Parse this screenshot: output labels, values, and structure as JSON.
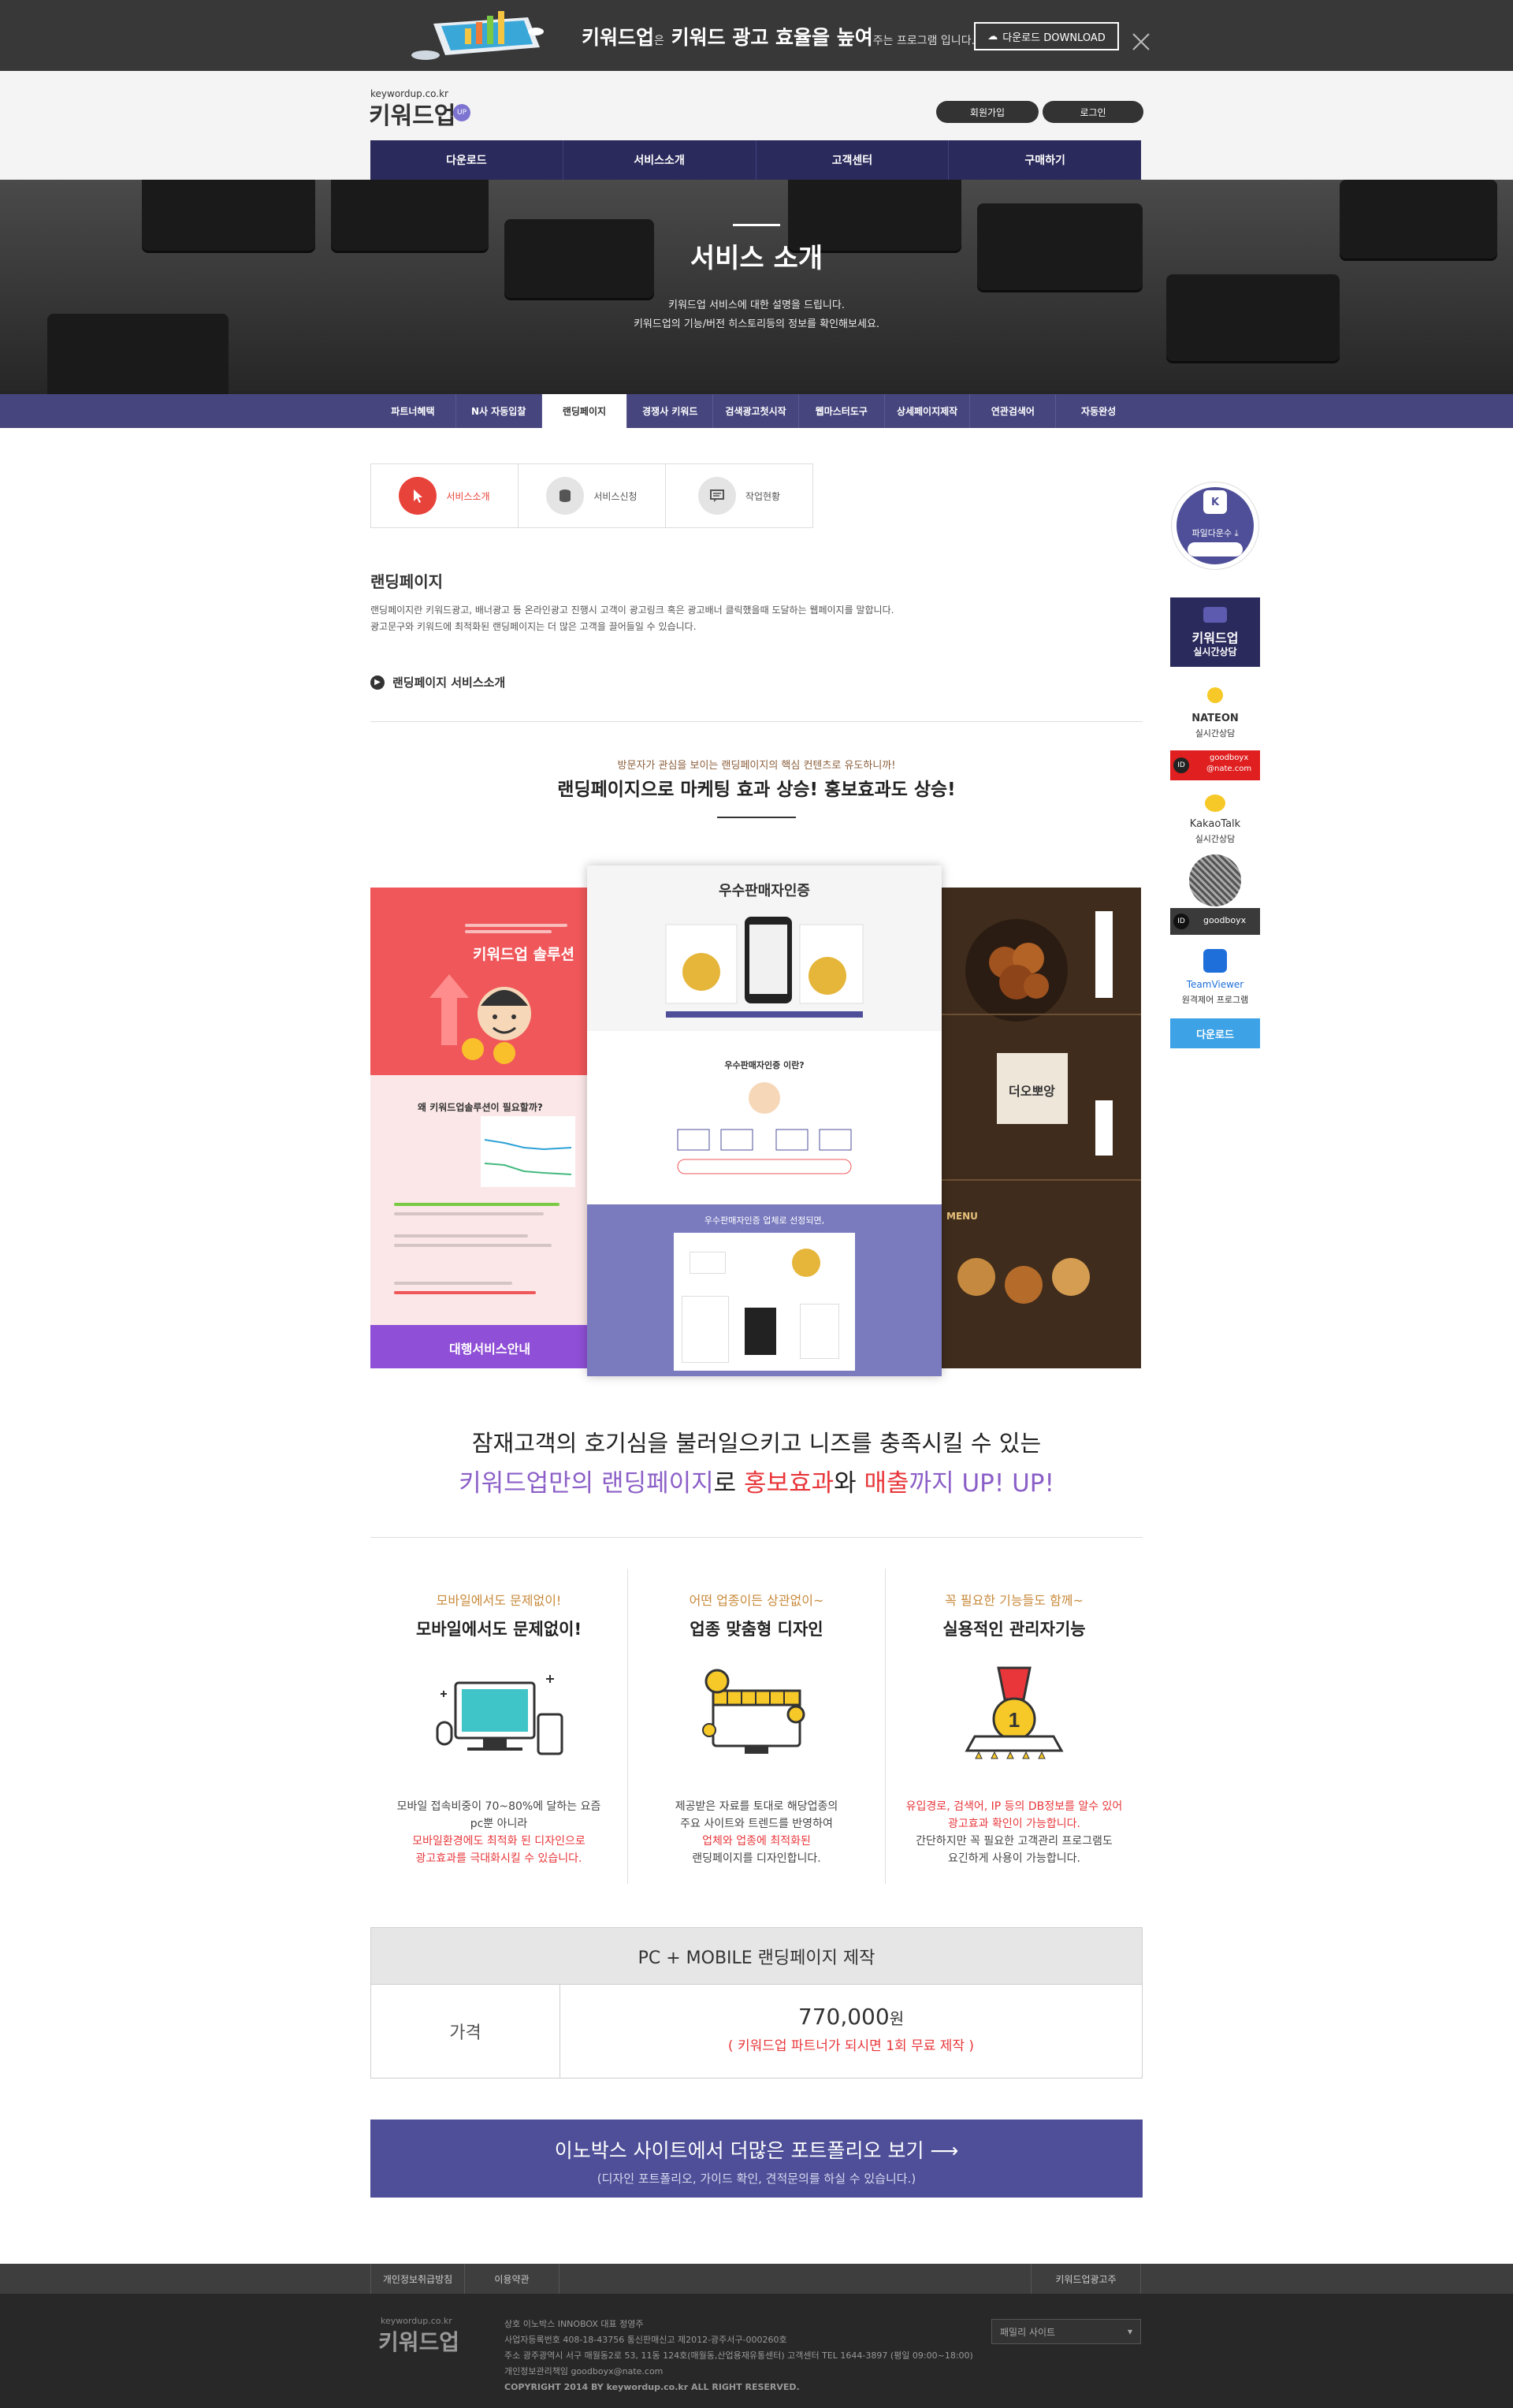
{
  "banner": {
    "slogan_main": "키워드업",
    "slogan_small1": "은",
    "slogan_mid": "키워드 광고 효율을 높여",
    "slogan_small2": "주는 프로그램 입니다.",
    "download_label": "다운로드 DOWNLOAD"
  },
  "header": {
    "logo_small": "keywordup.co.kr",
    "logo": "키워드업",
    "logo_badge": "UP",
    "join_label": "회원가입",
    "login_label": "로그인"
  },
  "gnb": [
    "다운로드",
    "서비스소개",
    "고객센터",
    "구매하기"
  ],
  "hero": {
    "title": "서비스 소개",
    "desc1": "키워드업 서비스에 대한 설명을 드립니다.",
    "desc2": "키워드업의 기능/버전 히스토리등의 정보를 확인해보세요."
  },
  "subnav": [
    "파트너혜택",
    "N사 자동입찰",
    "랜딩페이지",
    "경쟁사 키워드",
    "검색광고첫시작",
    "웹마스터도구",
    "상세페이지제작",
    "연관검색어",
    "자동완성"
  ],
  "subnav_active": 2,
  "tabs": [
    {
      "label": "서비스소개",
      "icon": "cursor-icon"
    },
    {
      "label": "서비스신청",
      "icon": "coins-icon"
    },
    {
      "label": "작업현황",
      "icon": "chat-icon"
    }
  ],
  "section": {
    "title": "랜딩페이지",
    "p1": "랜딩페이지란 키워드광고, 배너광고 등 온라인광고 진행시 고객이 광고링크 혹은 광고배너 클릭했을때 도달하는 웹페이지를 말합니다.",
    "p2": "광고문구와 키워드에 최적화된 랜딩페이지는 더 많은 고객을 끌어들일 수 있습니다.",
    "link": "랜딩페이지 서비스소개"
  },
  "promo": {
    "kicker": "방문자가 관심을 보이는 랜딩페이지의 핵심 컨텐츠로 유도하니까!",
    "headline": "랜딩페이지으로 마케팅 효과 상승! 홍보효과도 상승!"
  },
  "showcase": {
    "left_title": "키워드업 솔루션",
    "left_q": "왜 키워드업솔루션이 필요할까?",
    "left_bottom": "대행서비스안내",
    "center_title": "우수판매자인증",
    "center_q": "우수판매자인증 이란?",
    "center_bottom": "우수판매자인증 업체로 선정되면,",
    "right_menu": "MENU",
    "right_sign": "더오뽀앙"
  },
  "tagline": {
    "line1": "잠재고객의 호기심을 불러일으키고 니즈를 충족시킬 수 있는",
    "l2a": "키워드업만의 랜딩페이지",
    "l2b": "로 ",
    "l2c": "홍보효과",
    "l2d": "와 ",
    "l2e": "매출",
    "l2f": "까지 UP! UP!"
  },
  "features": [
    {
      "kicker": "모바일에서도 문제없이!",
      "title": "모바일에서도 문제없이!",
      "d1": "모바일 접속비중이 70~80%에 달하는 요즘",
      "d2": "pc뿐 아니라",
      "d3": "모바일환경에도 최적화 된 디자인으로",
      "d4": "광고효과를 극대화시킬 수 있습니다.",
      "icon": "devices-icon"
    },
    {
      "kicker": "어떤 업종이든 상관없이~",
      "title": "업종 맞춤형 디자인",
      "d1": "제공받은 자료를 토대로 해당업종의",
      "d2": "주요 사이트와 트렌드를 반영하여",
      "d3": "업체와 업종에 최적화된",
      "d4": "랜딩페이지를 디자인합니다.",
      "icon": "shop-icon"
    },
    {
      "kicker": "꼭 필요한 기능들도 함께~",
      "title": "실용적인 관리자기능",
      "d1": "유입경로, 검색어, IP 등의 DB정보를 알수 있어",
      "d2": "광고효과 확인이 가능합니다.",
      "d3": "간단하지만 꼭 필요한 고객관리 프로그램도",
      "d4": "요긴하게 사용이 가능합니다.",
      "icon": "medal-icon"
    }
  ],
  "price": {
    "header": "PC + MOBILE 랜딩페이지 제작",
    "label": "가격",
    "amount": "770,000",
    "unit": "원",
    "free": "( 키워드업 파트너가 되시면 1회 무료 제작 )"
  },
  "cta": {
    "title": "이노박스 사이트에서 더많은 포트폴리오 보기",
    "sub": "(디자인 포트폴리오, 가이드 확인, 견적문의를 하실 수 있습니다.)"
  },
  "quickbar": {
    "count_label": "파일다운수",
    "consult": "키워드업",
    "consult2": "실시간상담",
    "nate": "NATEON",
    "nate2": "실시간상담",
    "nate_id": "goodboyx",
    "nate_id2": "@nate.com",
    "kakao": "KakaoTalk",
    "kakao2": "실시간상담",
    "kakao_id": "goodboyx",
    "team": "TeamViewer",
    "team2": "원격제어 프로그램",
    "download": "다운로드"
  },
  "footer": {
    "nav_privacy": "개인정보취급방침",
    "nav_terms": "이용약관",
    "nav_right": "키워드업광고주",
    "logo_small": "keywordup.co.kr",
    "logo": "키워드업",
    "l1": "상호 이노박스 INNOBOX  대표 정영주",
    "l2": "사업자등록번호 408-18-43756  통신판매신고 제2012-광주서구-000260호",
    "l3": "주소 광주광역시 서구 매월동2로 53, 11동 124호(매월동,산업용재유통센터)  고객센터 TEL 1644-3897 (평일 09:00~18:00)",
    "l4": "개인정보관리책임 goodboyx@nate.com",
    "l5": "COPYRIGHT 2014 BY keywordup.co.kr ALL RIGHT RESERVED.",
    "family": "패밀리 사이트"
  },
  "colors": {
    "navy": "#2b2a5c",
    "subnav": "#46457e",
    "accent_red": "#e8433a",
    "purple": "#8b5fc7",
    "cta": "#4e4f98"
  }
}
